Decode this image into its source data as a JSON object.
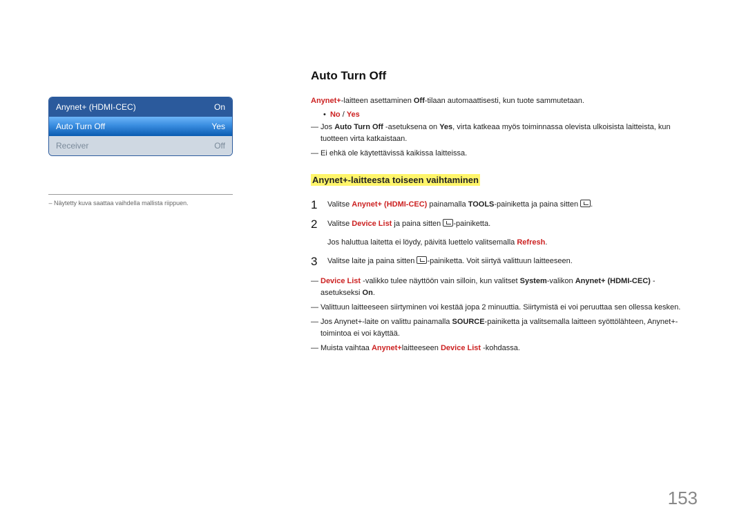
{
  "menu": {
    "header_label": "Anynet+ (HDMI-CEC)",
    "header_value": "On",
    "selected_label": "Auto Turn Off",
    "selected_value": "Yes",
    "disabled_label": "Receiver",
    "disabled_value": "Off"
  },
  "left_note": "Näytetty kuva saattaa vaihdella mallista riippuen.",
  "h2": "Auto Turn Off",
  "intro": {
    "prefix": "Anynet+",
    "mid1": "-laitteen asettaminen ",
    "off": "Off",
    "mid2": "-tilaan automaattisesti, kun tuote sammutetaan."
  },
  "bullet_no_yes": {
    "no": "No",
    "sep": " / ",
    "yes": "Yes"
  },
  "note1": {
    "a": "Jos ",
    "b": "Auto Turn Off",
    "c": " -asetuksena on ",
    "d": "Yes",
    "e": ", virta katkeaa myös toiminnassa olevista ulkoisista laitteista, kun tuotteen virta katkaistaan."
  },
  "note2": "Ei ehkä ole käytettävissä kaikissa laitteissa.",
  "subheading": "Anynet+-laitteesta toiseen vaihtaminen",
  "steps": {
    "s1": {
      "num": "1",
      "a": "Valitse ",
      "b": "Anynet+ (HDMI-CEC)",
      "c": " painamalla ",
      "d": "TOOLS",
      "e": "-painiketta ja paina sitten ",
      "f": "."
    },
    "s2": {
      "num": "2",
      "a": "Valitse ",
      "b": "Device List",
      "c": " ja paina sitten ",
      "d": "-painiketta.",
      "sub_a": "Jos haluttua laitetta ei löydy, päivitä luettelo valitsemalla ",
      "sub_b": "Refresh",
      "sub_c": "."
    },
    "s3": {
      "num": "3",
      "a": "Valitse laite ja paina sitten ",
      "b": "-painiketta. Voit siirtyä valittuun laitteeseen."
    }
  },
  "foot": {
    "f1": {
      "a": "Device List",
      "b": " -valikko tulee näyttöön vain silloin, kun valitset ",
      "c": "System",
      "d": "-valikon ",
      "e": "Anynet+ (HDMI-CEC)",
      "f": " -asetukseksi ",
      "g": "On",
      "h": "."
    },
    "f2": "Valittuun laitteeseen siirtyminen voi kestää jopa 2 minuuttia. Siirtymistä ei voi peruuttaa sen ollessa kesken.",
    "f3": {
      "a": "Jos Anynet+-laite on valittu painamalla ",
      "b": "SOURCE",
      "c": "-painiketta ja valitsemalla laitteen syöttölähteen, Anynet+-toimintoa ei voi käyttää."
    },
    "f4": {
      "a": "Muista vaihtaa ",
      "b": "Anynet+",
      "c": "laitteeseen ",
      "d": "Device List",
      "e": " -kohdassa."
    }
  },
  "page_number": "153"
}
